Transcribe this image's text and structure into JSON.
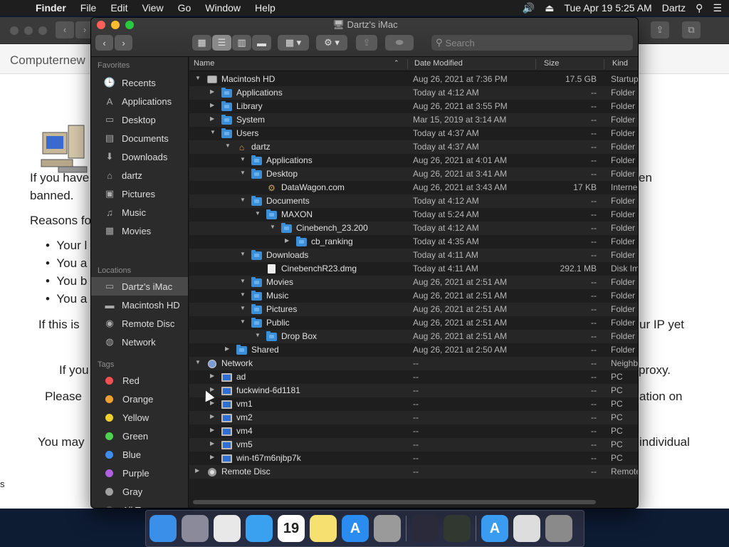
{
  "menubar": {
    "apple": "",
    "app": "Finder",
    "items": [
      "File",
      "Edit",
      "View",
      "Go",
      "Window",
      "Help"
    ],
    "clock": "Tue Apr 19  5:25 AM",
    "user": "Dartz"
  },
  "background_page": {
    "site": "Computernew",
    "paragraph1": "If you have",
    "paragraph1_end": "en",
    "paragraph1b": "banned.",
    "reasons": "Reasons fo",
    "bullets": [
      "Your l",
      "You a",
      "You b",
      "You a"
    ],
    "line_if_this": "If this is",
    "line_ip": "ur IP yet",
    "line_if_you": "If you",
    "line_proxy": "proxy.",
    "line_please": "Please",
    "line_ation": "ation on",
    "line_you_may": "You may",
    "line_individual": "individual",
    "edge_s": "s"
  },
  "finder": {
    "title": "Dartz's iMac",
    "search_placeholder": "Search",
    "sidebar": {
      "favorites_header": "Favorites",
      "favorites": [
        {
          "label": "Recents",
          "icon": "clock-icon",
          "glyph": "🕒"
        },
        {
          "label": "Applications",
          "icon": "applications-icon",
          "glyph": "A"
        },
        {
          "label": "Desktop",
          "icon": "desktop-icon",
          "glyph": "▭"
        },
        {
          "label": "Documents",
          "icon": "documents-icon",
          "glyph": "▤"
        },
        {
          "label": "Downloads",
          "icon": "downloads-icon",
          "glyph": "⬇"
        },
        {
          "label": "dartz",
          "icon": "home-icon",
          "glyph": "⌂"
        },
        {
          "label": "Pictures",
          "icon": "pictures-icon",
          "glyph": "▣"
        },
        {
          "label": "Music",
          "icon": "music-icon",
          "glyph": "♫"
        },
        {
          "label": "Movies",
          "icon": "movies-icon",
          "glyph": "▦"
        }
      ],
      "locations_header": "Locations",
      "locations": [
        {
          "label": "Dartz's iMac",
          "icon": "imac-icon",
          "glyph": "▭",
          "selected": true
        },
        {
          "label": "Macintosh HD",
          "icon": "hard-drive-icon",
          "glyph": "▬"
        },
        {
          "label": "Remote Disc",
          "icon": "remote-disc-icon",
          "glyph": "◉"
        },
        {
          "label": "Network",
          "icon": "network-icon",
          "glyph": "◍"
        }
      ],
      "tags_header": "Tags",
      "tags": [
        {
          "label": "Red",
          "color": "#f05050"
        },
        {
          "label": "Orange",
          "color": "#f0a030"
        },
        {
          "label": "Yellow",
          "color": "#f0d030"
        },
        {
          "label": "Green",
          "color": "#50d050"
        },
        {
          "label": "Blue",
          "color": "#3d8ef0"
        },
        {
          "label": "Purple",
          "color": "#b060e0"
        },
        {
          "label": "Gray",
          "color": "#a0a0a0"
        },
        {
          "label": "All Tags...",
          "color": "#555555"
        }
      ]
    },
    "columns": {
      "name": "Name",
      "date": "Date Modified",
      "size": "Size",
      "kind": "Kind"
    },
    "rows": [
      {
        "depth": 0,
        "tri": "▼",
        "icon": "drive",
        "name": "Macintosh HD",
        "date": "Aug 26, 2021 at 7:36 PM",
        "size": "17.5 GB",
        "kind": "Startup"
      },
      {
        "depth": 1,
        "tri": "▶",
        "icon": "fold",
        "name": "Applications",
        "date": "Today at 4:12 AM",
        "size": "--",
        "kind": "Folder"
      },
      {
        "depth": 1,
        "tri": "▶",
        "icon": "fold",
        "name": "Library",
        "date": "Aug 26, 2021 at 3:55 PM",
        "size": "--",
        "kind": "Folder"
      },
      {
        "depth": 1,
        "tri": "▶",
        "icon": "fold",
        "name": "System",
        "date": "Mar 15, 2019 at 3:14 AM",
        "size": "--",
        "kind": "Folder"
      },
      {
        "depth": 1,
        "tri": "▼",
        "icon": "fold",
        "name": "Users",
        "date": "Today at 4:37 AM",
        "size": "--",
        "kind": "Folder"
      },
      {
        "depth": 2,
        "tri": "▼",
        "icon": "home",
        "name": "dartz",
        "date": "Today at 4:37 AM",
        "size": "--",
        "kind": "Folder"
      },
      {
        "depth": 3,
        "tri": "▼",
        "icon": "fold",
        "name": "Applications",
        "date": "Aug 26, 2021 at 4:01 AM",
        "size": "--",
        "kind": "Folder"
      },
      {
        "depth": 3,
        "tri": "▼",
        "icon": "fold",
        "name": "Desktop",
        "date": "Aug 26, 2021 at 3:41 AM",
        "size": "--",
        "kind": "Folder"
      },
      {
        "depth": 4,
        "tri": "",
        "icon": "gear",
        "name": "DataWagon.com",
        "date": "Aug 26, 2021 at 3:43 AM",
        "size": "17 KB",
        "kind": "Interne"
      },
      {
        "depth": 3,
        "tri": "▼",
        "icon": "fold",
        "name": "Documents",
        "date": "Today at 4:12 AM",
        "size": "--",
        "kind": "Folder"
      },
      {
        "depth": 4,
        "tri": "▼",
        "icon": "fold",
        "name": "MAXON",
        "date": "Today at 5:24 AM",
        "size": "--",
        "kind": "Folder"
      },
      {
        "depth": 5,
        "tri": "▼",
        "icon": "fold",
        "name": "Cinebench_23.200",
        "date": "Today at 4:12 AM",
        "size": "--",
        "kind": "Folder"
      },
      {
        "depth": 6,
        "tri": "▶",
        "icon": "fold",
        "name": "cb_ranking",
        "date": "Today at 4:35 AM",
        "size": "--",
        "kind": "Folder"
      },
      {
        "depth": 3,
        "tri": "▼",
        "icon": "fold",
        "name": "Downloads",
        "date": "Today at 4:11 AM",
        "size": "--",
        "kind": "Folder"
      },
      {
        "depth": 4,
        "tri": "",
        "icon": "file",
        "name": "CinebenchR23.dmg",
        "date": "Today at 4:11 AM",
        "size": "292.1 MB",
        "kind": "Disk Im"
      },
      {
        "depth": 3,
        "tri": "▼",
        "icon": "fold",
        "name": "Movies",
        "date": "Aug 26, 2021 at 2:51 AM",
        "size": "--",
        "kind": "Folder"
      },
      {
        "depth": 3,
        "tri": "▼",
        "icon": "fold",
        "name": "Music",
        "date": "Aug 26, 2021 at 2:51 AM",
        "size": "--",
        "kind": "Folder"
      },
      {
        "depth": 3,
        "tri": "▼",
        "icon": "fold",
        "name": "Pictures",
        "date": "Aug 26, 2021 at 2:51 AM",
        "size": "--",
        "kind": "Folder"
      },
      {
        "depth": 3,
        "tri": "▼",
        "icon": "fold",
        "name": "Public",
        "date": "Aug 26, 2021 at 2:51 AM",
        "size": "--",
        "kind": "Folder"
      },
      {
        "depth": 4,
        "tri": "▼",
        "icon": "fold",
        "name": "Drop Box",
        "date": "Aug 26, 2021 at 2:51 AM",
        "size": "--",
        "kind": "Folder"
      },
      {
        "depth": 2,
        "tri": "▶",
        "icon": "fold",
        "name": "Shared",
        "date": "Aug 26, 2021 at 2:50 AM",
        "size": "--",
        "kind": "Folder"
      },
      {
        "depth": 0,
        "tri": "▼",
        "icon": "globe",
        "name": "Network",
        "date": "--",
        "size": "--",
        "kind": "Neighb"
      },
      {
        "depth": 1,
        "tri": "▶",
        "icon": "pc",
        "name": "ad",
        "date": "--",
        "size": "--",
        "kind": "PC"
      },
      {
        "depth": 1,
        "tri": "▶",
        "icon": "pc",
        "name": "fuckwind-6d1181",
        "date": "--",
        "size": "--",
        "kind": "PC"
      },
      {
        "depth": 1,
        "tri": "▶",
        "icon": "pc",
        "name": "vm1",
        "date": "--",
        "size": "--",
        "kind": "PC"
      },
      {
        "depth": 1,
        "tri": "▶",
        "icon": "pc",
        "name": "vm2",
        "date": "--",
        "size": "--",
        "kind": "PC"
      },
      {
        "depth": 1,
        "tri": "▶",
        "icon": "pc",
        "name": "vm4",
        "date": "--",
        "size": "--",
        "kind": "PC"
      },
      {
        "depth": 1,
        "tri": "▶",
        "icon": "pc",
        "name": "vm5",
        "date": "--",
        "size": "--",
        "kind": "PC"
      },
      {
        "depth": 1,
        "tri": "▶",
        "icon": "pc",
        "name": "win-t67m6njbp7k",
        "date": "--",
        "size": "--",
        "kind": "PC"
      },
      {
        "depth": 0,
        "tri": "▶",
        "icon": "disc",
        "name": "Remote Disc",
        "date": "--",
        "size": "--",
        "kind": "Remote"
      }
    ]
  },
  "dock": [
    {
      "name": "finder-dock-icon",
      "color": "#3a8fe8"
    },
    {
      "name": "launchpad-dock-icon",
      "color": "#8a8a9a"
    },
    {
      "name": "chrome-dock-icon",
      "color": "#e8e8e8"
    },
    {
      "name": "safari-dock-icon",
      "color": "#3aa0f0"
    },
    {
      "name": "calendar-dock-icon",
      "color": "#ffffff",
      "text": "19"
    },
    {
      "name": "notes-dock-icon",
      "color": "#f5e070"
    },
    {
      "name": "app-store-dock-icon",
      "color": "#2a8cf0",
      "text": "A"
    },
    {
      "name": "system-preferences-dock-icon",
      "color": "#9a9a9a"
    },
    {
      "sep": true
    },
    {
      "name": "cinema4d-dock-icon",
      "color": "#2a2a3a"
    },
    {
      "name": "activity-monitor-dock-icon",
      "color": "#303830"
    },
    {
      "sep": true
    },
    {
      "name": "app-store-download-dock-icon",
      "color": "#3a9cf0",
      "text": "A"
    },
    {
      "name": "document-dock-icon",
      "color": "#dddddd"
    },
    {
      "name": "trash-dock-icon",
      "color": "#8a8a8a"
    }
  ]
}
